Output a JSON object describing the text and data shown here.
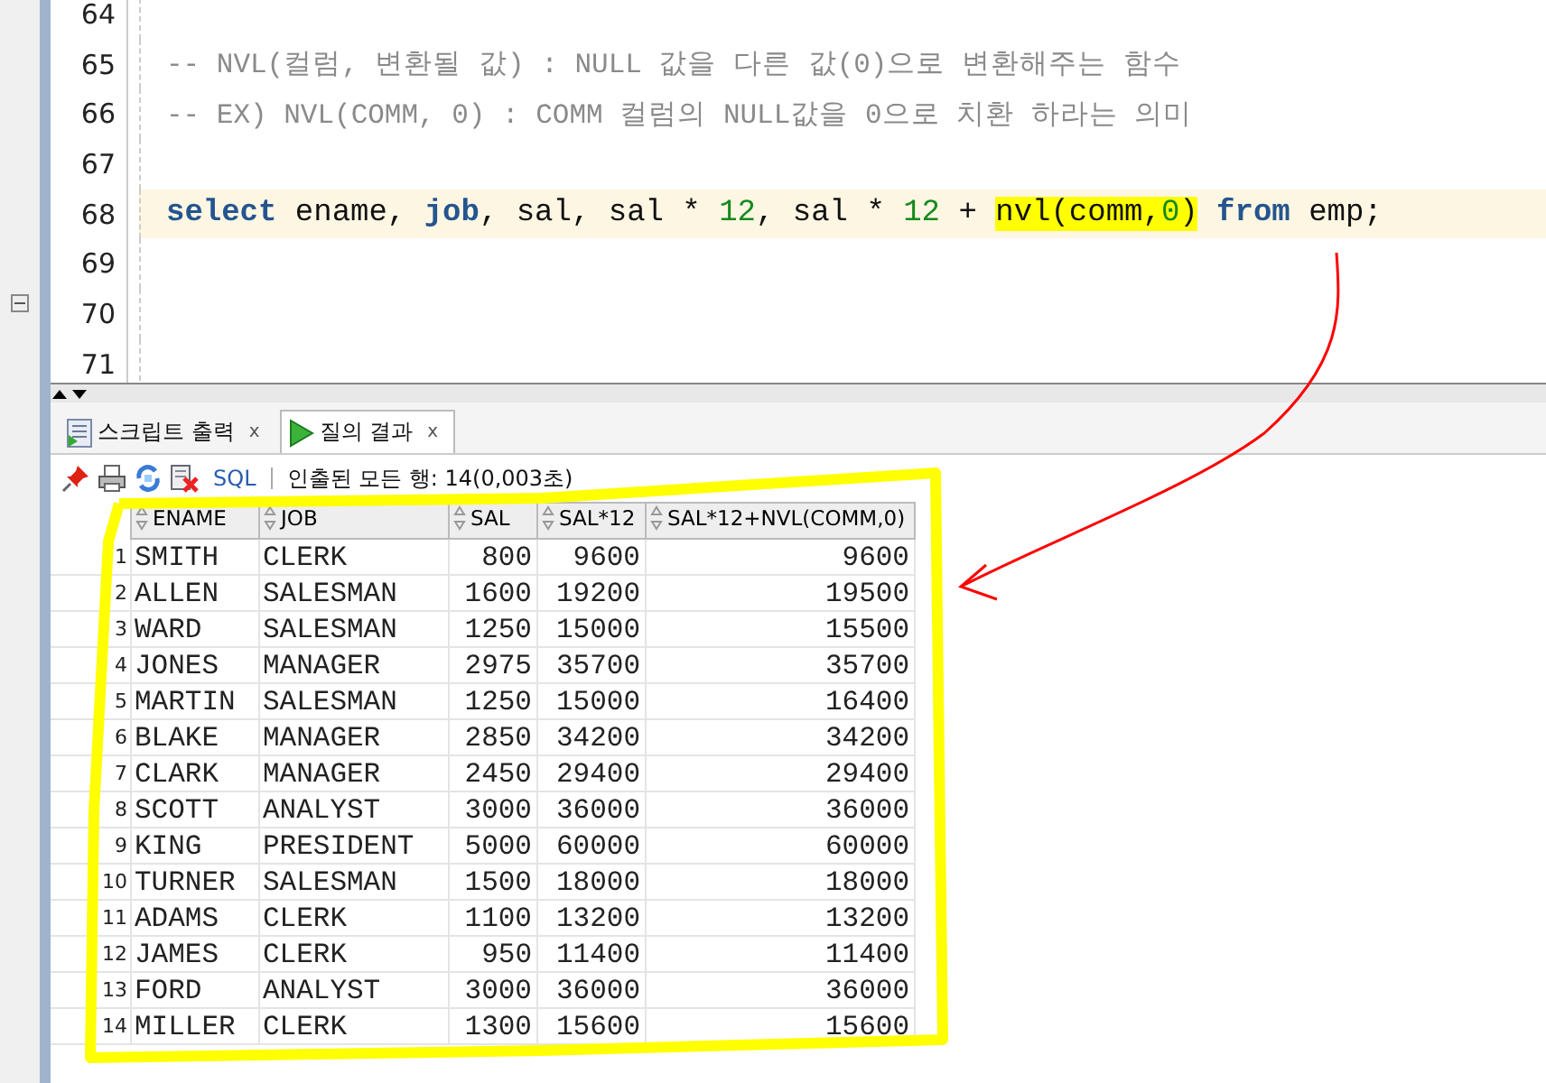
{
  "editor": {
    "lines": [
      {
        "number": "64",
        "kind": "blank"
      },
      {
        "number": "65",
        "kind": "comment",
        "text": "-- NVL(컬럼, 변환될 값) : NULL 값을 다른 값(0)으로 변환해주는 함수"
      },
      {
        "number": "66",
        "kind": "comment",
        "text": "-- EX) NVL(COMM, 0) : COMM 컬럼의 NULL값을 0으로 치환 하라는 의미"
      },
      {
        "number": "67",
        "kind": "blank"
      },
      {
        "number": "68",
        "kind": "code",
        "current": true,
        "tokens": [
          {
            "text": "select",
            "kind": "keyword",
            "marked": false
          },
          {
            "text": " ename, ",
            "kind": "plain",
            "marked": false
          },
          {
            "text": "job",
            "kind": "keyword",
            "marked": false
          },
          {
            "text": ", sal, sal * ",
            "kind": "plain",
            "marked": false
          },
          {
            "text": "12",
            "kind": "number",
            "marked": false
          },
          {
            "text": ", sal * ",
            "kind": "plain",
            "marked": false
          },
          {
            "text": "12",
            "kind": "number",
            "marked": false
          },
          {
            "text": " + ",
            "kind": "plain",
            "marked": false
          },
          {
            "text": "nvl(comm,",
            "kind": "plain",
            "marked": true
          },
          {
            "text": "0",
            "kind": "number",
            "marked": true
          },
          {
            "text": ")",
            "kind": "plain",
            "marked": true
          },
          {
            "text": " from",
            "kind": "keyword",
            "marked": false
          },
          {
            "text": " emp;",
            "kind": "plain",
            "marked": false
          }
        ]
      },
      {
        "number": "69",
        "kind": "blank"
      },
      {
        "number": "70",
        "kind": "blank"
      },
      {
        "number": "71",
        "kind": "blank"
      }
    ]
  },
  "tabs": [
    {
      "label": "스크립트 출력",
      "close": "x",
      "selected": false
    },
    {
      "label": "질의 결과",
      "close": "x",
      "selected": true
    }
  ],
  "toolbar": {
    "sql_link": "SQL",
    "status": "인출된 모든 행: 14(0,003초)"
  },
  "table": {
    "columns": [
      "",
      "ENAME",
      "JOB",
      "SAL",
      "SAL*12",
      "SAL*12+NVL(COMM,0)"
    ],
    "rows": [
      [
        "1",
        "SMITH",
        "CLERK",
        "800",
        "9600",
        "9600"
      ],
      [
        "2",
        "ALLEN",
        "SALESMAN",
        "1600",
        "19200",
        "19500"
      ],
      [
        "3",
        "WARD",
        "SALESMAN",
        "1250",
        "15000",
        "15500"
      ],
      [
        "4",
        "JONES",
        "MANAGER",
        "2975",
        "35700",
        "35700"
      ],
      [
        "5",
        "MARTIN",
        "SALESMAN",
        "1250",
        "15000",
        "16400"
      ],
      [
        "6",
        "BLAKE",
        "MANAGER",
        "2850",
        "34200",
        "34200"
      ],
      [
        "7",
        "CLARK",
        "MANAGER",
        "2450",
        "29400",
        "29400"
      ],
      [
        "8",
        "SCOTT",
        "ANALYST",
        "3000",
        "36000",
        "36000"
      ],
      [
        "9",
        "KING",
        "PRESIDENT",
        "5000",
        "60000",
        "60000"
      ],
      [
        "10",
        "TURNER",
        "SALESMAN",
        "1500",
        "18000",
        "18000"
      ],
      [
        "11",
        "ADAMS",
        "CLERK",
        "1100",
        "13200",
        "13200"
      ],
      [
        "12",
        "JAMES",
        "CLERK",
        "950",
        "11400",
        "11400"
      ],
      [
        "13",
        "FORD",
        "ANALYST",
        "3000",
        "36000",
        "36000"
      ],
      [
        "14",
        "MILLER",
        "CLERK",
        "1300",
        "15600",
        "15600"
      ]
    ]
  },
  "annotations": [
    {
      "kind": "outline",
      "color": "#ffff00"
    },
    {
      "kind": "arrow",
      "color": "#ff0000"
    }
  ]
}
